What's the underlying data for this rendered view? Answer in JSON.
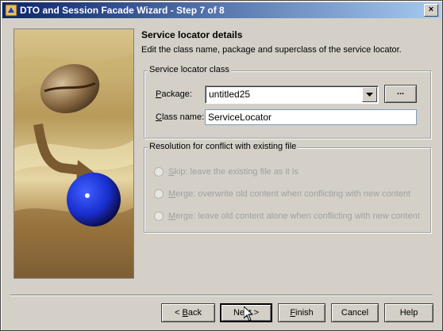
{
  "window": {
    "title": "DTO and Session Facade Wizard - Step 7 of 8",
    "close_label": "×"
  },
  "panel": {
    "heading": "Service locator details",
    "description": "Edit the class name, package and superclass of the service locator."
  },
  "service_locator_group": {
    "title": "Service locator class",
    "package_label_ul": "P",
    "package_label_rest": "ackage:",
    "package_value": "untitled25",
    "browse_label": "...",
    "classname_label_ul": "C",
    "classname_label_rest": "lass name:",
    "classname_value": "ServiceLocator"
  },
  "conflict_group": {
    "title": "Resolution for conflict with existing file",
    "options": [
      {
        "ul": "S",
        "rest": "kip: leave the existing file as it is",
        "enabled": false
      },
      {
        "ul": "M",
        "rest": "erge: overwrite old content when conflicting with new content",
        "enabled": false
      },
      {
        "ul": "M",
        "rest": "erge: leave old content alone when conflicting with new content",
        "enabled": false
      }
    ]
  },
  "buttons": {
    "back_prefix": "< ",
    "back_ul": "B",
    "back_rest": "ack",
    "next_prefix": "Ne",
    "next_ul": "x",
    "next_rest": "t >",
    "finish_ul": "F",
    "finish_rest": "inish",
    "cancel": "Cancel",
    "help": "Help"
  },
  "icons": {
    "title_icon": "wizard-app-icon",
    "art": "coffee-bean-to-blue-sphere-illustration",
    "dropdown": "chevron-down-icon",
    "cursor": "mouse-pointer-icon"
  },
  "colors": {
    "titlebar_start": "#0a246a",
    "titlebar_end": "#a6caf0",
    "dialog_bg": "#d4d0c8",
    "disabled_text": "#a0a0a0",
    "sphere_blue": "#1a2fd0"
  }
}
